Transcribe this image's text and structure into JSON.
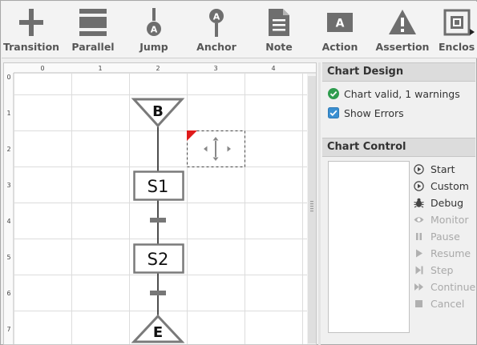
{
  "toolbar": {
    "items": [
      {
        "label": "Transition",
        "icon": "transition-icon"
      },
      {
        "label": "Parallel",
        "icon": "parallel-icon"
      },
      {
        "label": "Jump",
        "icon": "jump-icon",
        "badge": "A"
      },
      {
        "label": "Anchor",
        "icon": "anchor-icon",
        "badge": "A"
      },
      {
        "label": "Note",
        "icon": "note-icon"
      },
      {
        "label": "Action",
        "icon": "action-icon",
        "badge": "A"
      },
      {
        "label": "Assertion",
        "icon": "assertion-icon"
      },
      {
        "label": "Enclos",
        "icon": "enclosing-icon"
      }
    ]
  },
  "canvas": {
    "column_labels": [
      "0",
      "1",
      "2",
      "3",
      "4"
    ],
    "row_labels": [
      "0",
      "1",
      "2",
      "3",
      "4",
      "5",
      "6",
      "7"
    ],
    "begin_label": "B",
    "steps": [
      "S1",
      "S2"
    ],
    "end_label": "E"
  },
  "chart_design": {
    "title": "Chart Design",
    "status": "Chart valid, 1 warnings",
    "show_errors_label": "Show Errors",
    "show_errors_checked": true
  },
  "chart_control": {
    "title": "Chart Control",
    "buttons": [
      {
        "label": "Start",
        "icon": "play-circle-icon",
        "enabled": true
      },
      {
        "label": "Custom",
        "icon": "play-circle-icon",
        "enabled": true
      },
      {
        "label": "Debug",
        "icon": "bug-icon",
        "enabled": true
      },
      {
        "label": "Monitor",
        "icon": "eye-icon",
        "enabled": false
      },
      {
        "label": "Pause",
        "icon": "pause-icon",
        "enabled": false
      },
      {
        "label": "Resume",
        "icon": "play-icon",
        "enabled": false
      },
      {
        "label": "Step",
        "icon": "step-icon",
        "enabled": false
      },
      {
        "label": "Continue",
        "icon": "fast-forward-icon",
        "enabled": false
      },
      {
        "label": "Cancel",
        "icon": "stop-icon",
        "enabled": false
      }
    ]
  },
  "colors": {
    "toolbar_icon": "#6e6e6e",
    "accent_blue": "#3a8fd1",
    "valid_green": "#2e9c4e",
    "warning_red": "#e01b1b",
    "step_border": "#7a7a7a",
    "transition_bar": "#777777",
    "grid_line": "#dcdcdc"
  }
}
